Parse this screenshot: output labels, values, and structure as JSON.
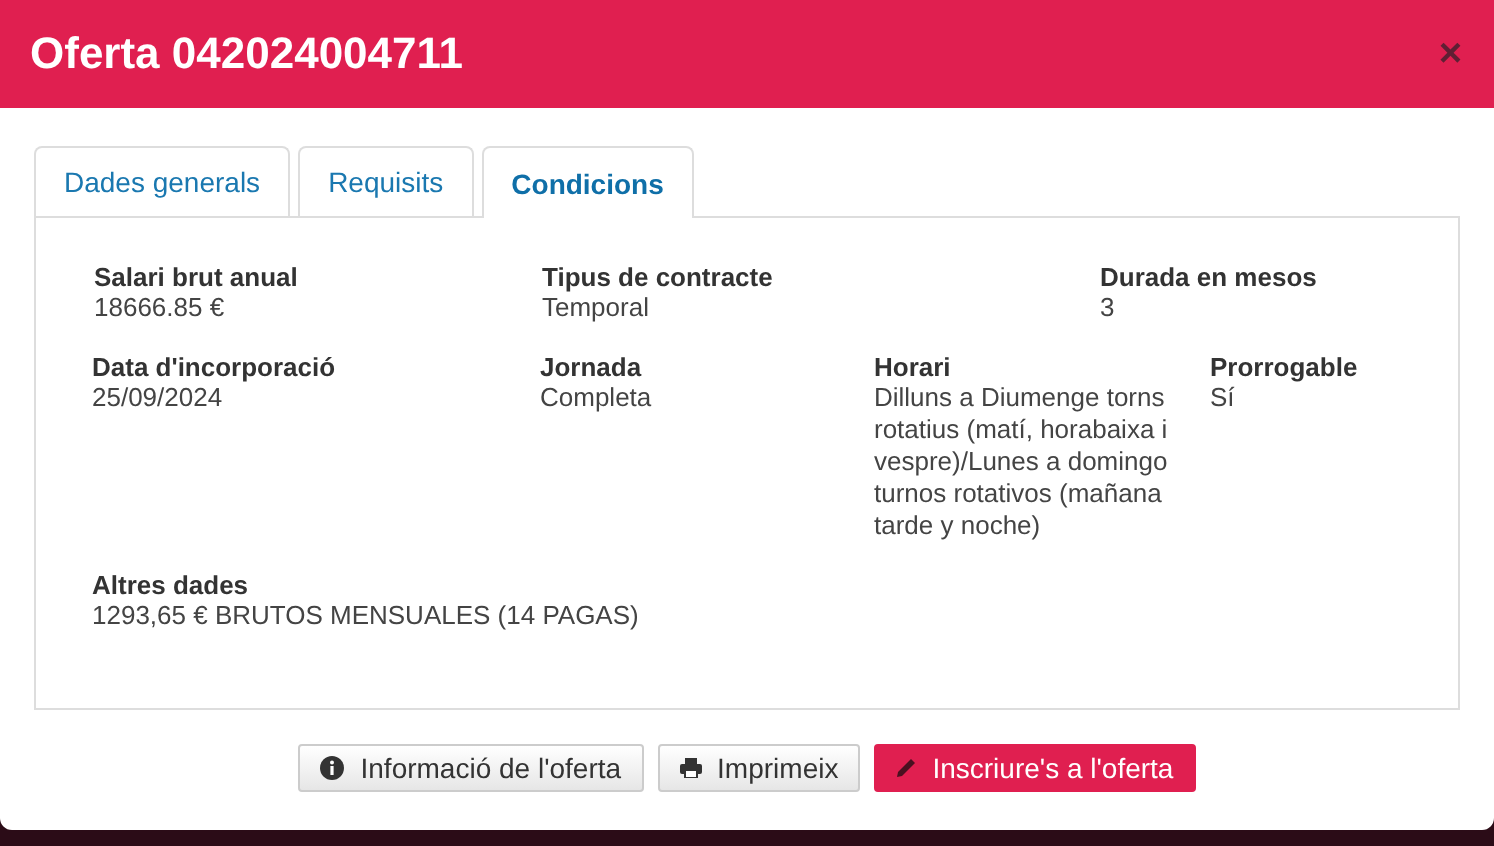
{
  "window": {
    "title": "Oferta 042024004711",
    "close": "×"
  },
  "tabs": [
    {
      "label": "Dades generals",
      "selected": false
    },
    {
      "label": "Requisits",
      "selected": false
    },
    {
      "label": "Condicions",
      "selected": true
    }
  ],
  "field_rows": [
    [
      {
        "label": "Salari brut anual",
        "value": "18666.85 €"
      },
      {
        "label": "Tipus de contracte",
        "value": "Temporal"
      },
      {
        "label": "Durada en mesos",
        "value": "3"
      }
    ],
    [
      {
        "label": "Data d'incorporació",
        "value": "25/09/2024"
      },
      {
        "label": "Jornada",
        "value": "Completa"
      },
      {
        "label": "Horari",
        "value": "Dilluns a Diumenge torns rotatius (matí, horabaixa i vespre)/Lunes a domingo turnos rotativos (mañana tarde y noche)"
      },
      {
        "label": "Prorrogable",
        "value": "Sí"
      }
    ],
    [
      {
        "label": "Altres dades",
        "value": "1293,65 € BRUTOS MENSUALES (14 PAGAS)"
      }
    ]
  ],
  "buttons": [
    {
      "label": "Informació de l'oferta",
      "kind": "info"
    },
    {
      "label": "Imprimeix",
      "kind": "print"
    },
    {
      "label": "Inscriure's a l'oferta",
      "kind": "primary"
    }
  ]
}
